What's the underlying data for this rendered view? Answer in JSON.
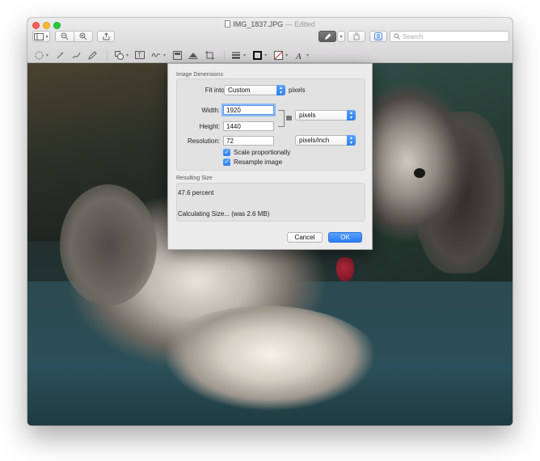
{
  "window": {
    "filename": "IMG_1837.JPG",
    "separator": "—",
    "edited_label": "Edited"
  },
  "toolbar": {
    "search_placeholder": "Search"
  },
  "dialog": {
    "image_dimensions_label": "Image Dimensions",
    "fit_into_label": "Fit into:",
    "fit_into_value": "Custom",
    "fit_into_unit": "pixels",
    "width_label": "Width:",
    "width_value": "1920",
    "height_label": "Height:",
    "height_value": "1440",
    "size_unit_value": "pixels",
    "resolution_label": "Resolution:",
    "resolution_value": "72",
    "resolution_unit_value": "pixels/inch",
    "scale_proportionally_label": "Scale proportionally",
    "scale_proportionally_checked": true,
    "resample_label": "Resample image",
    "resample_checked": true,
    "resulting_size_label": "Resulting Size",
    "percent_text": "47.6 percent",
    "calculating_text": "Calculating Size... (was 2.6 MB)",
    "cancel_label": "Cancel",
    "ok_label": "OK"
  },
  "colors": {
    "accent": "#2d7ff2",
    "close": "#fc5f57",
    "minimize": "#fdbc2e",
    "zoom": "#28c840"
  }
}
